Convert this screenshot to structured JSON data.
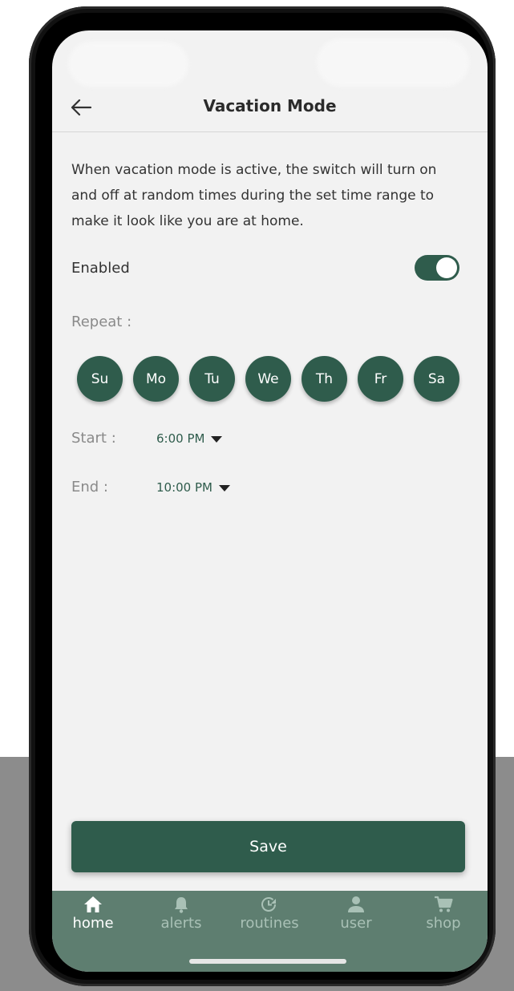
{
  "header": {
    "title": "Vacation Mode",
    "back_icon": "arrow-left-icon"
  },
  "description": "When vacation mode is active, the switch will turn on and off at random times during the set time range to make it look like you are at home.",
  "enabled": {
    "label": "Enabled",
    "value": true
  },
  "repeat": {
    "label": "Repeat :",
    "days": [
      "Su",
      "Mo",
      "Tu",
      "We",
      "Th",
      "Fr",
      "Sa"
    ]
  },
  "start": {
    "label": "Start :",
    "value": "6:00 PM"
  },
  "end": {
    "label": "End :",
    "value": "10:00 PM"
  },
  "save_label": "Save",
  "tabbar": {
    "items": [
      {
        "label": "home",
        "icon": "home-icon",
        "active": true
      },
      {
        "label": "alerts",
        "icon": "bell-icon",
        "active": false
      },
      {
        "label": "routines",
        "icon": "clock-refresh-icon",
        "active": false
      },
      {
        "label": "user",
        "icon": "user-icon",
        "active": false
      },
      {
        "label": "shop",
        "icon": "cart-icon",
        "active": false
      }
    ]
  },
  "colors": {
    "accent": "#2f5c4c",
    "tabbar": "#5e7e70",
    "screen_bg": "#f2f2f2"
  }
}
